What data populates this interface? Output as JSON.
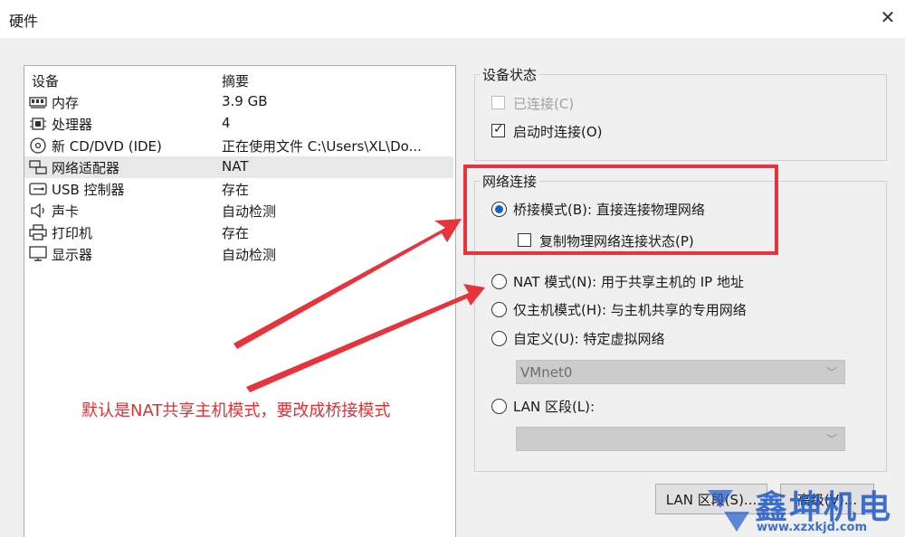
{
  "window": {
    "title": "硬件"
  },
  "device_list": {
    "headers": {
      "device": "设备",
      "summary": "摘要"
    },
    "rows": [
      {
        "name": "内存",
        "summary": "3.9 GB",
        "icon": "memory-icon"
      },
      {
        "name": "处理器",
        "summary": "4",
        "icon": "cpu-icon"
      },
      {
        "name": "新 CD/DVD (IDE)",
        "summary": "正在使用文件 C:\\Users\\XL\\Do...",
        "icon": "cd-dvd-icon"
      },
      {
        "name": "网络适配器",
        "summary": "NAT",
        "icon": "network-adapter-icon",
        "selected": true
      },
      {
        "name": "USB 控制器",
        "summary": "存在",
        "icon": "usb-icon"
      },
      {
        "name": "声卡",
        "summary": "自动检测",
        "icon": "speaker-icon"
      },
      {
        "name": "打印机",
        "summary": "存在",
        "icon": "printer-icon"
      },
      {
        "name": "显示器",
        "summary": "自动检测",
        "icon": "monitor-icon"
      }
    ]
  },
  "device_status": {
    "title": "设备状态",
    "connected": {
      "label": "已连接(C)",
      "checked": false,
      "enabled": false
    },
    "connect_on_start": {
      "label": "启动时连接(O)",
      "checked": true,
      "enabled": true
    }
  },
  "network": {
    "title": "网络连接",
    "bridged": {
      "label": "桥接模式(B): 直接连接物理网络",
      "selected": true
    },
    "replicate": {
      "label": "复制物理网络连接状态(P)",
      "checked": false
    },
    "nat": {
      "label": "NAT 模式(N): 用于共享主机的 IP 地址"
    },
    "host_only": {
      "label": "仅主机模式(H): 与主机共享的专用网络"
    },
    "custom": {
      "label": "自定义(U): 特定虚拟网络"
    },
    "vmnet_select": {
      "value": "VMnet0"
    },
    "lan": {
      "label": "LAN 区段(L):"
    },
    "lan_select": {
      "value": ""
    }
  },
  "buttons": {
    "lan_segments": "LAN 区段(S)...",
    "advanced": "高级(V)..."
  },
  "annotation": {
    "text": "默认是NAT共享主机模式，要改成桥接模式",
    "color": "#e8323c"
  },
  "watermark": {
    "text": "鑫坤机电",
    "url": "www.xzxkjd.com"
  },
  "colors": {
    "radio_selected": "#0b64c8",
    "accent_red": "#e8323c"
  }
}
